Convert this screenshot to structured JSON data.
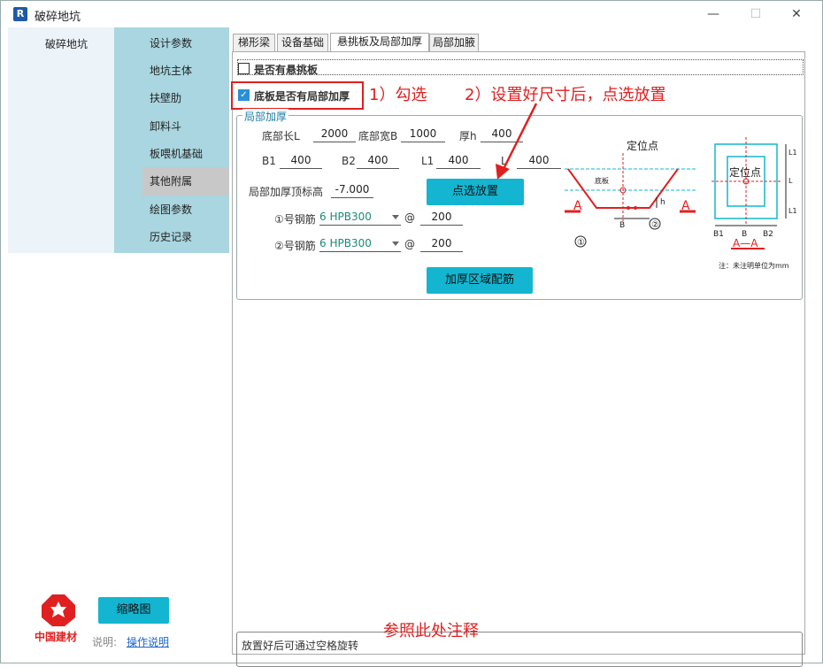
{
  "window": {
    "title": "破碎地坑",
    "app_icon": "R"
  },
  "left_panel": {
    "heading": "破碎地坑"
  },
  "nav": {
    "items": [
      {
        "label": "设计参数"
      },
      {
        "label": "地坑主体"
      },
      {
        "label": "扶壁肋"
      },
      {
        "label": "卸料斗"
      },
      {
        "label": "板喂机基础"
      },
      {
        "label": "其他附属"
      },
      {
        "label": "绘图参数"
      },
      {
        "label": "历史记录"
      }
    ],
    "selected": "其他附属"
  },
  "tabs": [
    {
      "label": "梯形梁"
    },
    {
      "label": "设备基础"
    },
    {
      "label": "悬挑板及局部加厚"
    },
    {
      "label": "局部加腋"
    }
  ],
  "form": {
    "overhang_label": "是否有悬挑板",
    "local_thicken_label": "底板是否有局部加厚",
    "group_title": "局部加厚",
    "bottom_len_label": "底部长L",
    "bottom_len": "2000",
    "bottom_wid_label": "底部宽B",
    "bottom_wid": "1000",
    "thick_label": "厚h",
    "thick": "400",
    "b1_label": "B1",
    "b1": "400",
    "b2_label": "B2",
    "b2": "400",
    "l1_label": "L1",
    "l1": "400",
    "l2_label": "L",
    "l2": "400",
    "top_elev_label": "局部加厚顶标高",
    "top_elev": "-7.000",
    "place_button": "点选放置",
    "rebar1_label": "①号钢筋",
    "rebar1": "6 HPB300",
    "rebar1_at": "@",
    "rebar1_spacing": "200",
    "rebar2_label": "②号钢筋",
    "rebar2": "6 HPB300",
    "rebar2_at": "@",
    "rebar2_spacing": "200",
    "reinforce_button": "加厚区域配筋"
  },
  "diagram": {
    "locate1": "定位点",
    "locate2": "定位点",
    "slab": "底板",
    "section": "A",
    "section2": "A",
    "circle1": "①",
    "circle2": "②",
    "h": "h",
    "b": "B",
    "bb1": "B1",
    "bb": "B",
    "bb2": "B2",
    "aa": "A—A",
    "unit_note": "注：未注明单位为mm",
    "l1a": "L1",
    "l": "L",
    "l1b": "L1"
  },
  "annotations": {
    "step1": "1）勾选",
    "step2": "2）设置好尺寸后，点选放置",
    "step3": "参照此处注释"
  },
  "note": {
    "text": "放置好后可通过空格旋转"
  },
  "footer": {
    "thumb_button": "缩略图",
    "logo_text": "中国建材",
    "explain_label": "说明:",
    "explain_link": "操作说明"
  },
  "colors": {
    "accent": "#14b5d0",
    "nav_bg": "#a9d6e0",
    "annotation": "#e02020"
  }
}
